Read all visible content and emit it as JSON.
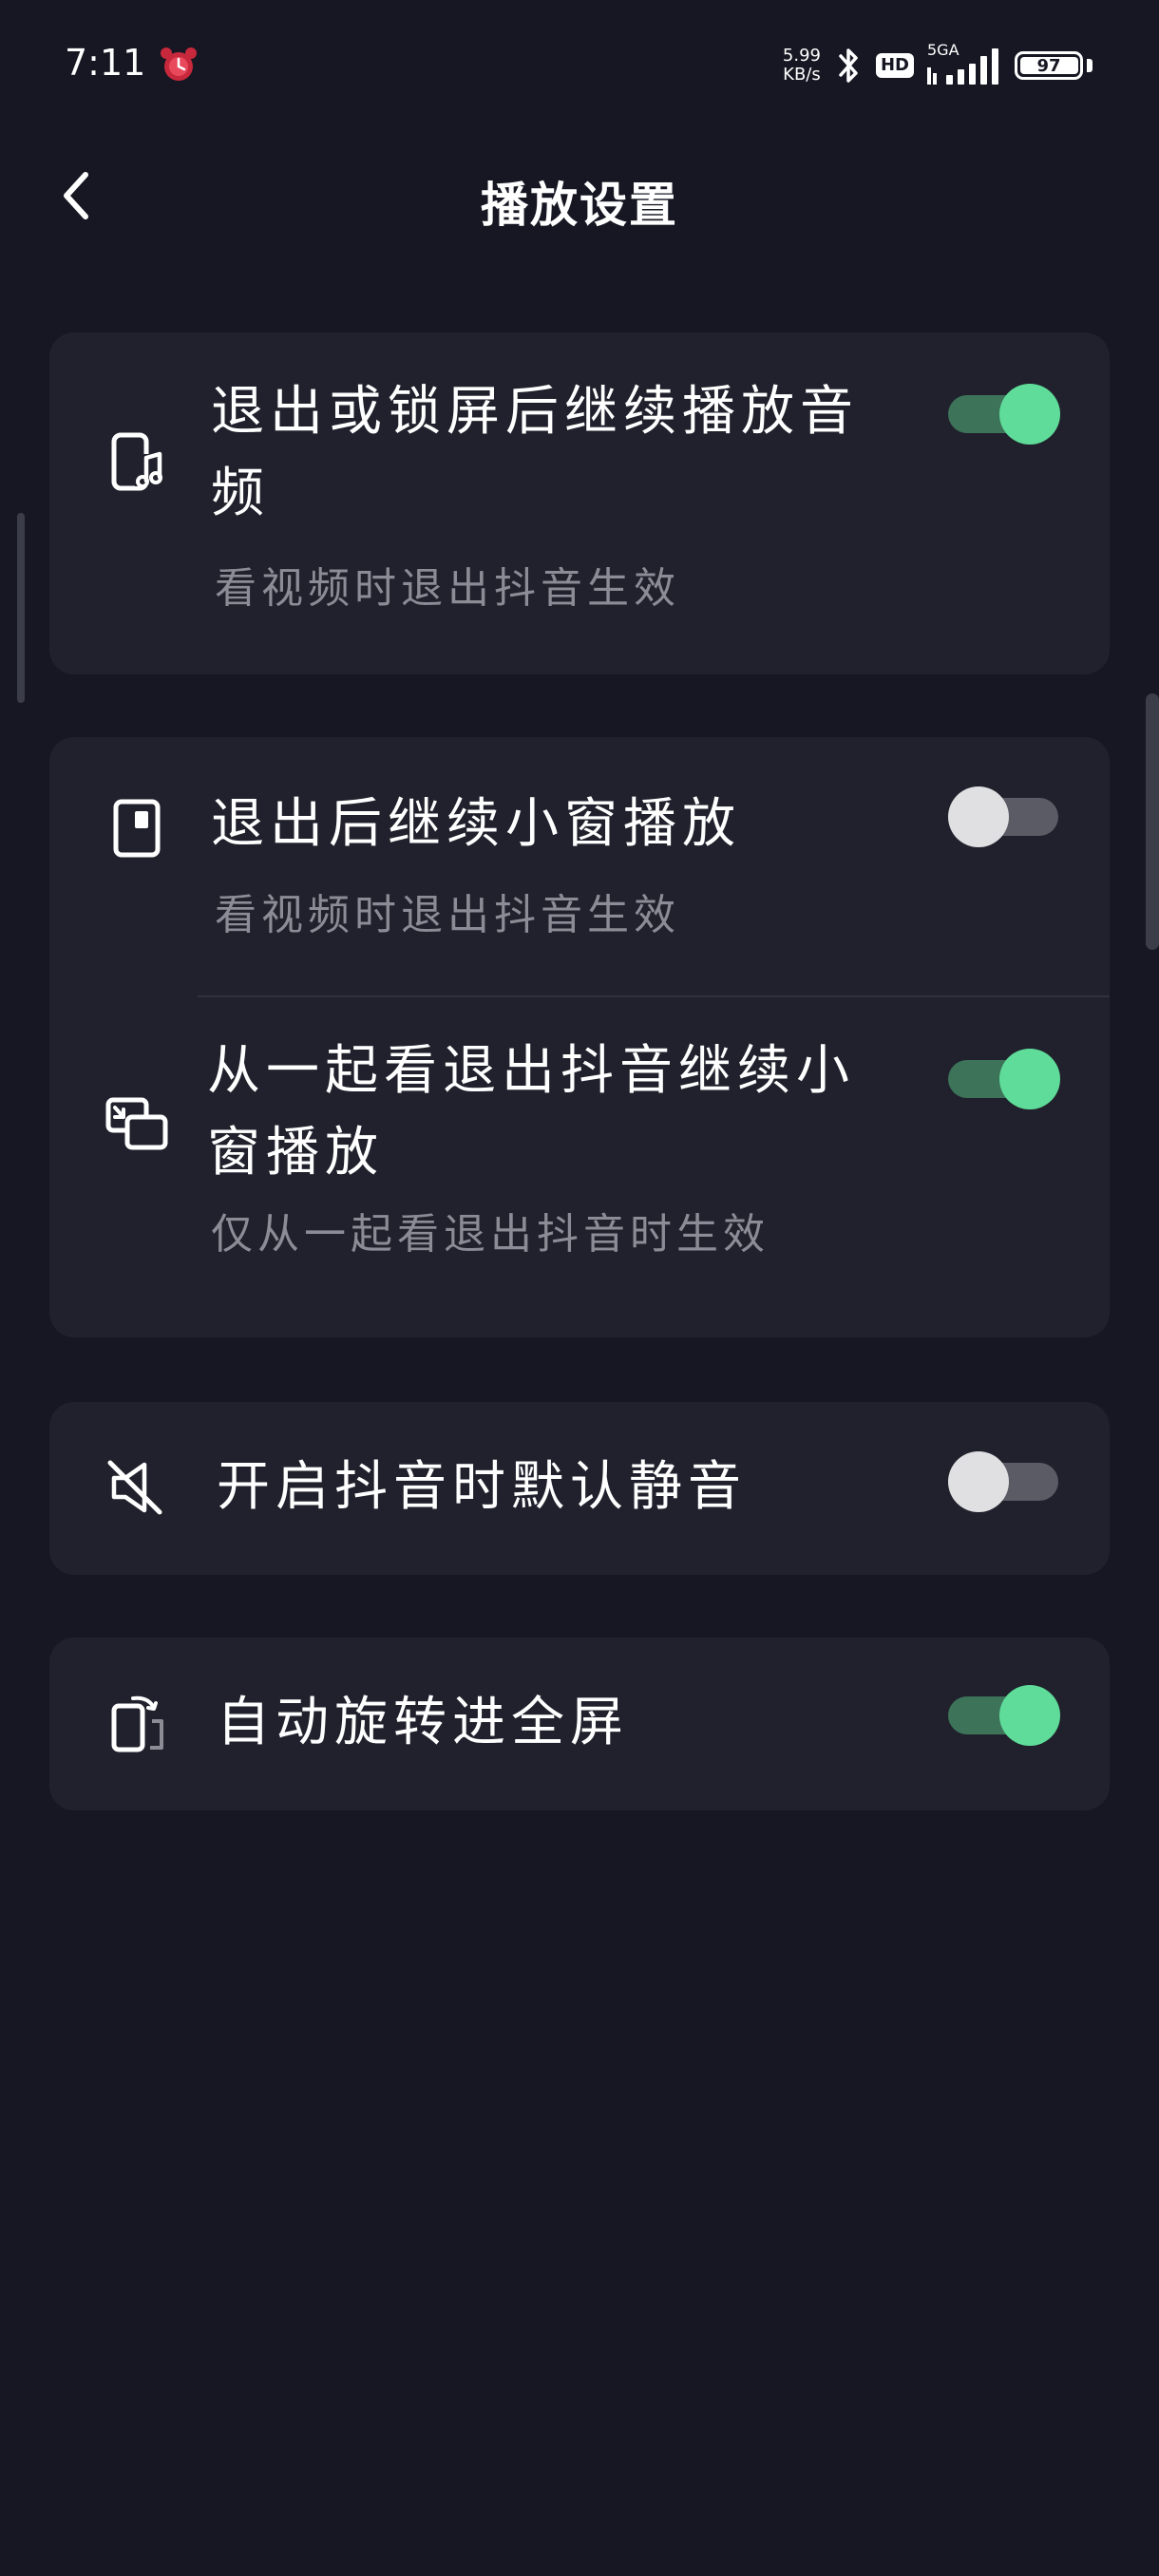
{
  "status_bar": {
    "time": "7:11",
    "net_speed_value": "5.99",
    "net_speed_unit": "KB/s",
    "hd_label": "HD",
    "network_label": "5GA",
    "battery": "97"
  },
  "header": {
    "title": "播放设置"
  },
  "settings": {
    "background_audio": {
      "title_line1": "退出或锁屏后继续播放音",
      "title_line2": "频",
      "subtitle": "看视频时退出抖音生效",
      "enabled": true,
      "icon": "phone-music-icon"
    },
    "mini_window": {
      "title": "退出后继续小窗播放",
      "subtitle": "看视频时退出抖音生效",
      "enabled": false,
      "icon": "mini-window-icon"
    },
    "watch_together_mini_window": {
      "title_line1": "从一起看退出抖音继续小",
      "title_line2": "窗播放",
      "subtitle": "仅从一起看退出抖音时生效",
      "enabled": true,
      "icon": "picture-in-picture-icon"
    },
    "default_mute": {
      "title": "开启抖音时默认静音",
      "enabled": false,
      "icon": "mute-icon"
    },
    "auto_rotate": {
      "title": "自动旋转进全屏",
      "enabled": true,
      "icon": "screen-rotate-icon"
    }
  },
  "colors": {
    "background": "#161722",
    "card": "#20212c",
    "toggle_on": "#5fdc99",
    "toggle_off": "#e0e0e3",
    "subtitle": "#8b8c95"
  }
}
